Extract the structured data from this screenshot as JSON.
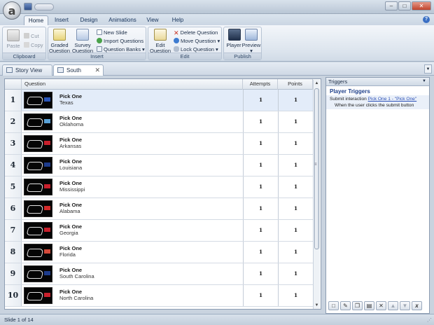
{
  "app": {
    "orb_letter": "a",
    "window_controls": [
      "–",
      "□",
      "✕"
    ]
  },
  "ribbon_tabs": [
    "Home",
    "Insert",
    "Design",
    "Animations",
    "View",
    "Help"
  ],
  "ribbon": {
    "clipboard": {
      "label": "Clipboard",
      "paste": "Paste",
      "cut": "Cut",
      "copy": "Copy"
    },
    "insert": {
      "label": "Insert",
      "graded_question": [
        "Graded",
        "Question"
      ],
      "survey_question": [
        "Survey",
        "Question"
      ],
      "new_slide": "New Slide",
      "import_questions": "Import Questions",
      "question_banks": "Question Banks"
    },
    "edit": {
      "label": "Edit",
      "edit_question": [
        "Edit",
        "Question"
      ],
      "delete_question": "Delete Question",
      "move_question": "Move Question",
      "lock_question": "Lock Question"
    },
    "publish": {
      "label": "Publish",
      "player": "Player",
      "preview": "Preview"
    }
  },
  "doc_tabs": [
    "Story View",
    "South"
  ],
  "grid": {
    "headers": {
      "question": "Question",
      "attempts": "Attempts",
      "points": "Points"
    },
    "rows": [
      {
        "num": "1",
        "type": "Pick One",
        "name": "Texas",
        "attempts": "1",
        "points": "1",
        "flag": "#2b56b8"
      },
      {
        "num": "2",
        "type": "Pick One",
        "name": "Oklahoma",
        "attempts": "1",
        "points": "1",
        "flag": "#5aa2d8"
      },
      {
        "num": "3",
        "type": "Pick One",
        "name": "Arkansas",
        "attempts": "1",
        "points": "1",
        "flag": "#c8202c"
      },
      {
        "num": "4",
        "type": "Pick One",
        "name": "Louisiana",
        "attempts": "1",
        "points": "1",
        "flag": "#1e3c8c"
      },
      {
        "num": "5",
        "type": "Pick One",
        "name": "Mississippi",
        "attempts": "1",
        "points": "1",
        "flag": "#c8202c"
      },
      {
        "num": "6",
        "type": "Pick One",
        "name": "Alabama",
        "attempts": "1",
        "points": "1",
        "flag": "#d42a2a"
      },
      {
        "num": "7",
        "type": "Pick One",
        "name": "Georgia",
        "attempts": "1",
        "points": "1",
        "flag": "#c8202c"
      },
      {
        "num": "8",
        "type": "Pick One",
        "name": "Florida",
        "attempts": "1",
        "points": "1",
        "flag": "#d44a3a"
      },
      {
        "num": "9",
        "type": "Pick One",
        "name": "South Carolina",
        "attempts": "1",
        "points": "1",
        "flag": "#1e3c8c"
      },
      {
        "num": "10",
        "type": "Pick One",
        "name": "North Carolina",
        "attempts": "1",
        "points": "1",
        "flag": "#c8202c"
      }
    ]
  },
  "triggers": {
    "panel_title": "Triggers",
    "section_title": "Player Triggers",
    "trigger_prefix": "Submit interaction",
    "trigger_link": "Pick One 1 - \"Pick One\"",
    "trigger_condition": "When the user clicks the submit button"
  },
  "status": {
    "text": "Slide 1 of 14"
  },
  "colors": {
    "accent": "#1d3f8a",
    "link": "#2b4fb6",
    "selected_row": "#e3ecf9"
  }
}
